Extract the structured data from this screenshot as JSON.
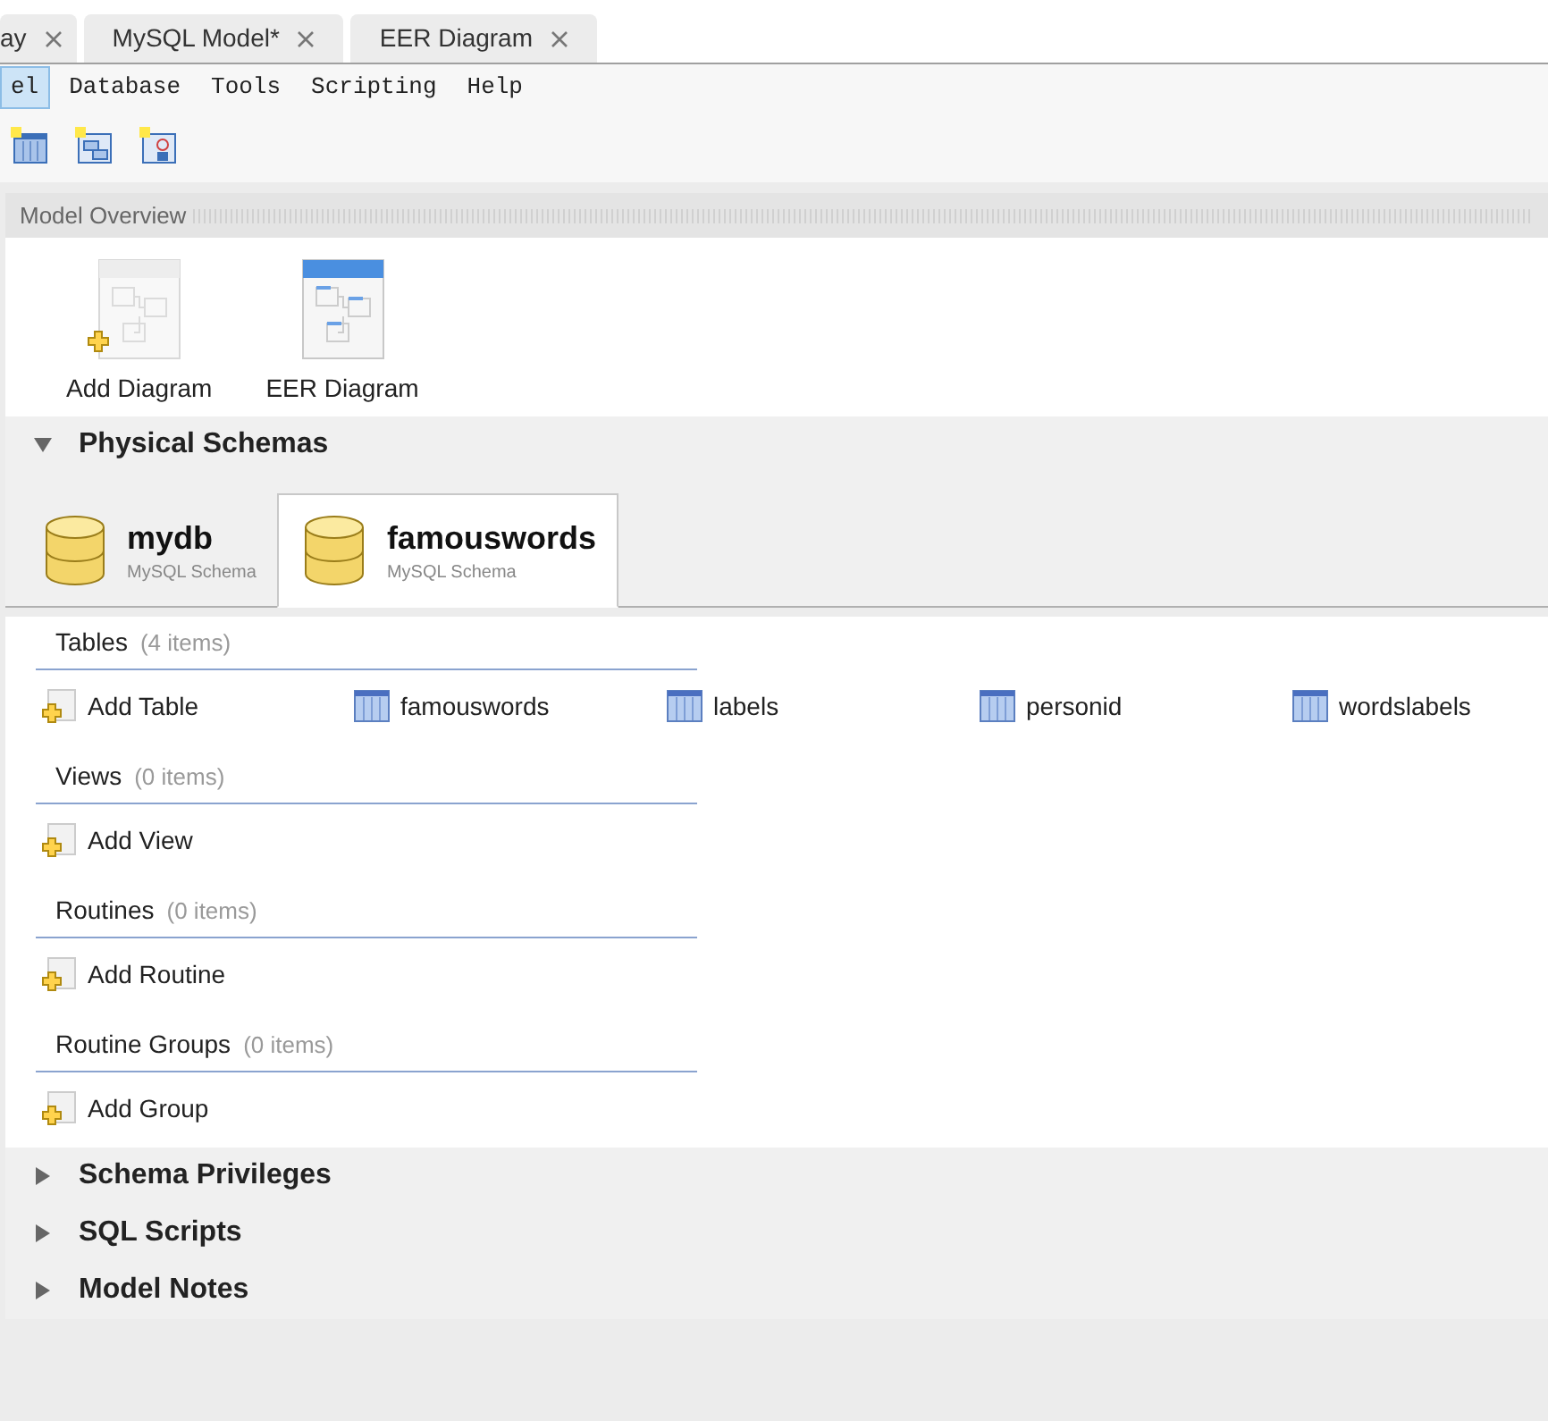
{
  "doc_tabs": [
    {
      "label": "ay"
    },
    {
      "label": "MySQL Model*"
    },
    {
      "label": "EER Diagram"
    }
  ],
  "menu": [
    {
      "label": "el",
      "selected": true
    },
    {
      "label": "Database",
      "selected": false
    },
    {
      "label": "Tools",
      "selected": false
    },
    {
      "label": "Scripting",
      "selected": false
    },
    {
      "label": "Help",
      "selected": false
    }
  ],
  "model_overview": {
    "title": "Model Overview",
    "diagrams": [
      {
        "kind": "add",
        "label": "Add Diagram"
      },
      {
        "kind": "diagram",
        "label": "EER Diagram"
      }
    ]
  },
  "physical_schemas": {
    "title": "Physical Schemas",
    "expanded": true,
    "schemas": [
      {
        "name": "mydb",
        "subtitle": "MySQL Schema",
        "selected": false
      },
      {
        "name": "famouswords",
        "subtitle": "MySQL Schema",
        "selected": true
      }
    ],
    "groups": [
      {
        "title": "Tables",
        "count": "(4 items)",
        "items": [
          {
            "kind": "add",
            "label": "Add Table"
          },
          {
            "kind": "table",
            "label": "famouswords"
          },
          {
            "kind": "table",
            "label": "labels"
          },
          {
            "kind": "table",
            "label": "personid"
          },
          {
            "kind": "table",
            "label": "wordslabels"
          }
        ]
      },
      {
        "title": "Views",
        "count": "(0 items)",
        "items": [
          {
            "kind": "add",
            "label": "Add View"
          }
        ]
      },
      {
        "title": "Routines",
        "count": "(0 items)",
        "items": [
          {
            "kind": "add",
            "label": "Add Routine"
          }
        ]
      },
      {
        "title": "Routine Groups",
        "count": "(0 items)",
        "items": [
          {
            "kind": "add",
            "label": "Add Group"
          }
        ]
      }
    ]
  },
  "sections": [
    {
      "title": "Schema Privileges",
      "expanded": false
    },
    {
      "title": "SQL Scripts",
      "expanded": false
    },
    {
      "title": "Model Notes",
      "expanded": false
    }
  ]
}
